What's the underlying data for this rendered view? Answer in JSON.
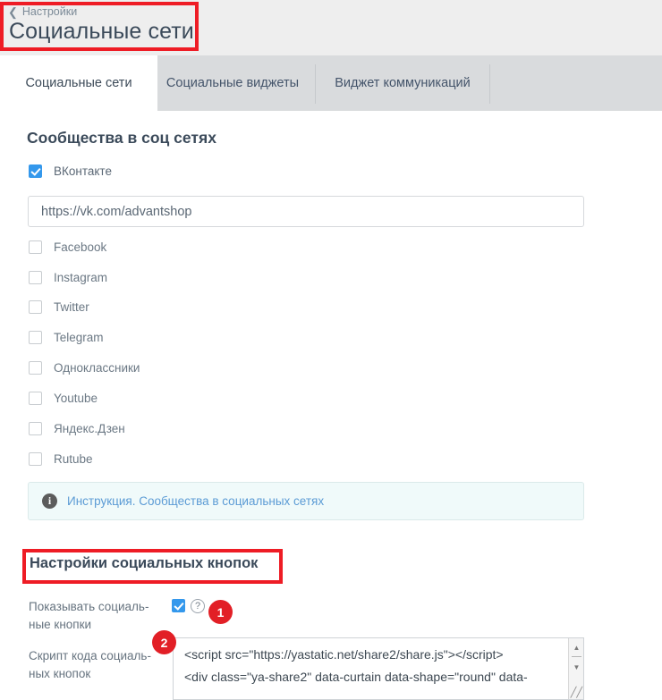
{
  "header": {
    "breadcrumb_label": "Настройки",
    "breadcrumb_icon": "chevron-left-icon",
    "title": "Социальные сети"
  },
  "tabs": [
    {
      "label": "Социальные сети",
      "active": true
    },
    {
      "label": "Социальные виджеты",
      "active": false
    },
    {
      "label": "Виджет коммуникаций",
      "active": false
    }
  ],
  "main": {
    "section_title": "Сообщества в соц сетях",
    "networks": [
      {
        "label": "ВКонтакте",
        "checked": true
      },
      {
        "label": "Facebook",
        "checked": false
      },
      {
        "label": "Instagram",
        "checked": false
      },
      {
        "label": "Twitter",
        "checked": false
      },
      {
        "label": "Telegram",
        "checked": false
      },
      {
        "label": "Одноклассники",
        "checked": false
      },
      {
        "label": "Youtube",
        "checked": false
      },
      {
        "label": "Яндекс.Дзен",
        "checked": false
      },
      {
        "label": "Rutube",
        "checked": false
      }
    ],
    "vk_url": {
      "value": "https://vk.com/advantshop",
      "placeholder": "https://vk.com/"
    },
    "info_box": {
      "icon": "info-icon",
      "link_text": "Инструкция. Сообщества в социальных сетях"
    },
    "social_buttons": {
      "subheading": "Настройки социальных кнопок",
      "show_buttons_label": "Показывать социаль-\nные кнопки",
      "show_buttons_label_line1": "Показывать социаль-",
      "show_buttons_label_line2": "ные кнопки",
      "show_buttons_checked": true,
      "help_icon": "question-mark-icon",
      "script_label_line1": "Скрипт кода социаль-",
      "script_label_line2": "ных кнопок",
      "script_value_line1": "<script src=\"https://yastatic.net/share2/share.js\"></scr",
      "script_value_line1_tail": "ipt>",
      "script_value_line2": "<div class=\"ya-share2\" data-curtain data-shape=\"round\" data-"
    }
  },
  "annotations": [
    {
      "number": "1",
      "color": "#e21f26",
      "target": "show-social-buttons-checkbox"
    },
    {
      "number": "2",
      "color": "#e21f26",
      "target": "social-buttons-script-textarea"
    }
  ],
  "colors": {
    "header_bg": "#eeeeee",
    "tabbar_bg": "#d9dbdd",
    "accent": "#3498ec",
    "annotation_red": "#ee1c25",
    "info_bg": "#f0fafa",
    "link": "#5b9bd5"
  }
}
